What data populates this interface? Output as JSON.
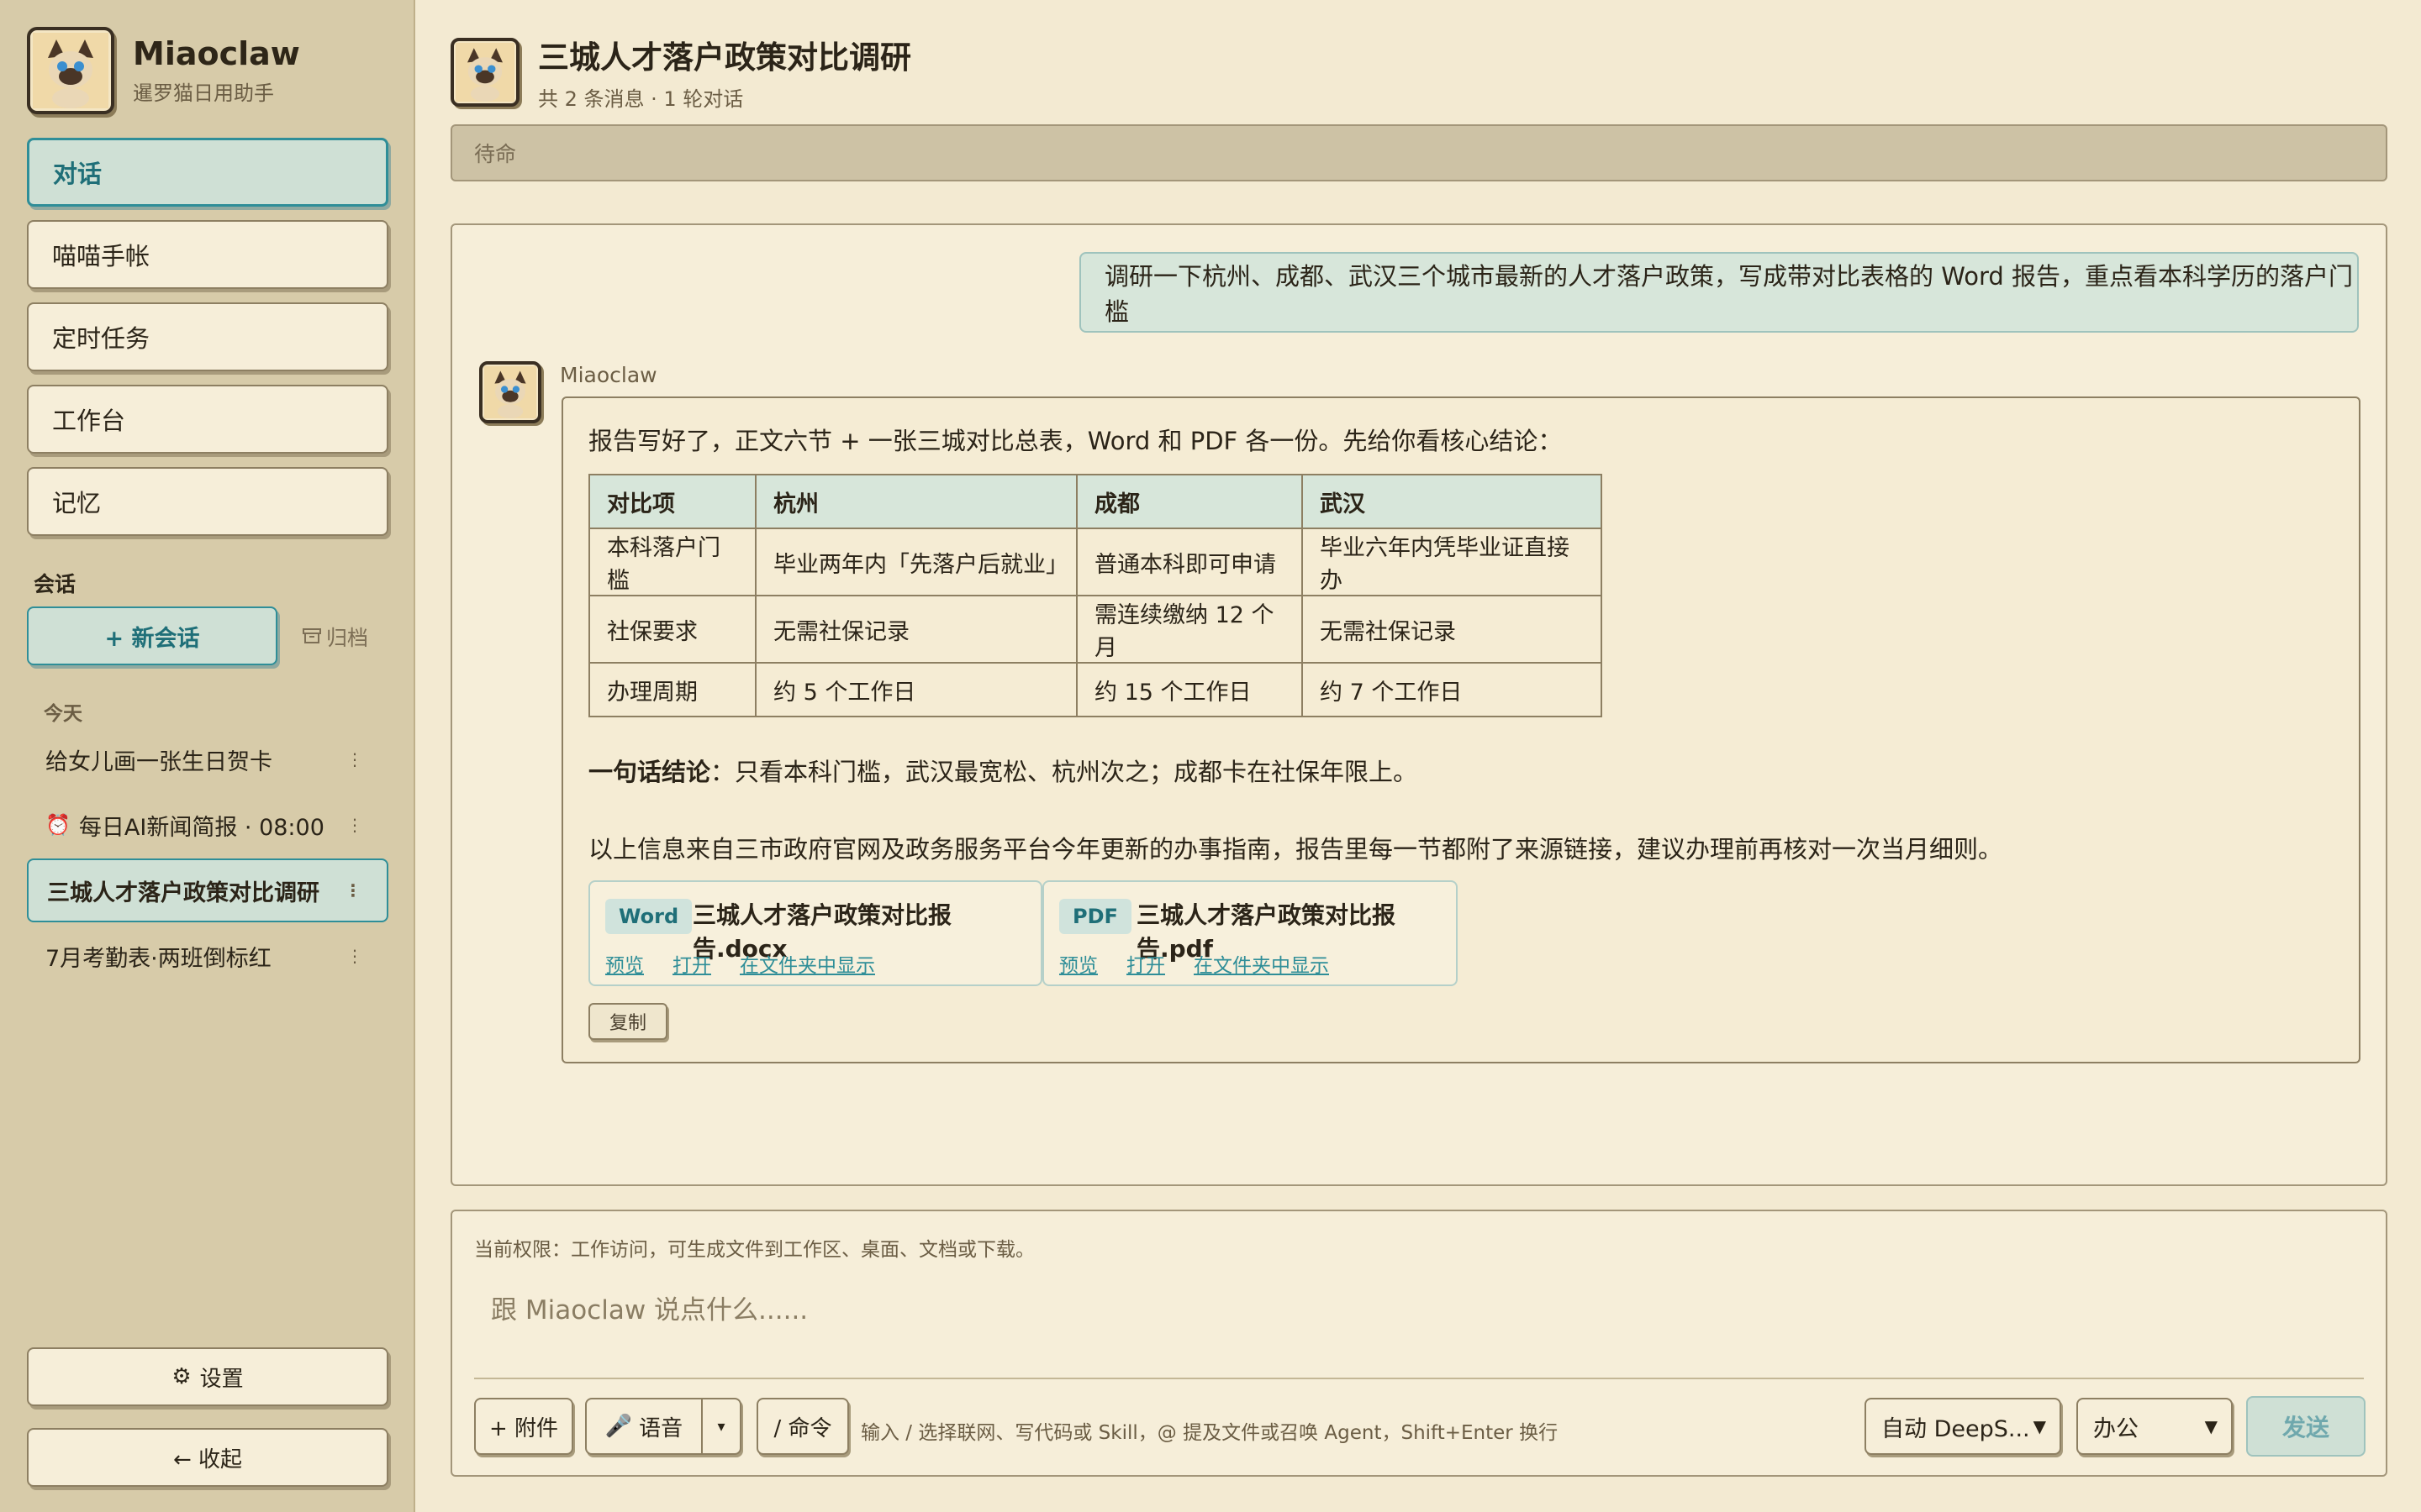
{
  "brand": {
    "title": "Miaoclaw",
    "subtitle": "暹罗猫日用助手"
  },
  "nav": {
    "items": [
      {
        "label": "对话"
      },
      {
        "label": "喵喵手帐"
      },
      {
        "label": "定时任务"
      },
      {
        "label": "工作台"
      },
      {
        "label": "记忆"
      }
    ]
  },
  "sessions": {
    "label": "会话",
    "new_label": "+ 新会话",
    "archive_label": "归档",
    "group_today": "今天",
    "items": [
      {
        "title": "给女儿画一张生日贺卡"
      },
      {
        "title": "每日AI新闻简报 · 08:00"
      },
      {
        "title": "三城人才落户政策对比调研"
      },
      {
        "title": "7月考勤表·两班倒标红"
      }
    ]
  },
  "sidebar_bottom": {
    "settings": "设置",
    "collapse": "← 收起"
  },
  "header": {
    "title": "三城人才落户政策对比调研",
    "subtitle": "共 2 条消息 · 1 轮对话"
  },
  "status": "待命",
  "chat": {
    "user_message": "调研一下杭州、成都、武汉三个城市最新的人才落户政策，写成带对比表格的 Word 报告，重点看本科学历的落户门槛",
    "bot_name": "Miaoclaw",
    "intro": "报告写好了，正文六节 + 一张三城对比总表，Word 和 PDF 各一份。先给你看核心结论：",
    "table": {
      "headers": [
        "对比项",
        "杭州",
        "成都",
        "武汉"
      ],
      "rows": [
        [
          "本科落户门槛",
          "毕业两年内「先落户后就业」",
          "普通本科即可申请",
          "毕业六年内凭毕业证直接办"
        ],
        [
          "社保要求",
          "无需社保记录",
          "需连续缴纳 12 个月",
          "无需社保记录"
        ],
        [
          "办理周期",
          "约 5 个工作日",
          "约 15 个工作日",
          "约 7 个工作日"
        ]
      ]
    },
    "summary_bold": "一句话结论",
    "summary_text": "：只看本科门槛，武汉最宽松、杭州次之；成都卡在社保年限上。",
    "source_note": "以上信息来自三市政府官网及政务服务平台今年更新的办事指南，报告里每一节都附了来源链接，建议办理前再核对一次当月细则。",
    "files": [
      {
        "tag": "Word",
        "name": "三城人才落户政策对比报告.docx"
      },
      {
        "tag": "PDF",
        "name": "三城人才落户政策对比报告.pdf"
      }
    ],
    "file_actions": {
      "preview": "预览",
      "open": "打开",
      "reveal": "在文件夹中显示"
    },
    "copy_label": "复制"
  },
  "composer": {
    "permission": "当前权限：工作访问，可生成文件到工作区、桌面、文档或下载。",
    "placeholder": "跟 Miaoclaw 说点什么......",
    "attach": "+ 附件",
    "voice": "语音",
    "command": "/ 命令",
    "hint": "输入 / 选择联网、写代码或 Skill，@ 提及文件或召唤 Agent，Shift+Enter 换行",
    "model": "自动 DeepS...",
    "mode": "办公",
    "send": "发送"
  },
  "colors": {
    "accent": "#2f8e98",
    "sidebar_bg": "#d7cba9",
    "page_bg": "#f3ead2"
  },
  "icons": [
    "cat-avatar-icon",
    "archive-icon",
    "alarm-icon",
    "gear-icon",
    "microphone-icon",
    "caret-down-icon"
  ]
}
